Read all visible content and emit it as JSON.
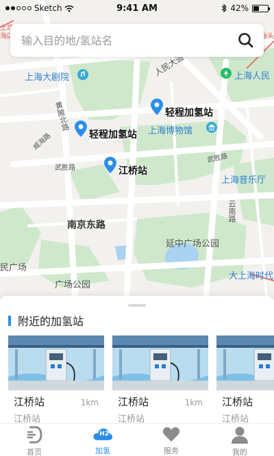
{
  "status_bar": {
    "carrier": "Sketch",
    "time": "9:41 AM",
    "battery": "42%",
    "battery_level": 0.42
  },
  "search": {
    "placeholder": "输入目的地/氢站名"
  },
  "map": {
    "labels": {
      "shanghai_grand_theatre": "上海大剧院",
      "peoples_avenue": "人民大道",
      "shanghai_peoples": "上海人民",
      "huangpi_north_road": "黄陂北路",
      "weihai_road": "威海路",
      "wusheng_road_left": "武胜路",
      "shanghai_museum": "上海博物馆",
      "wusheng_road_right": "武胜路",
      "shanghai_concert_hall": "上海音乐厅",
      "nanjing_east_road": "南京东路",
      "yunnan_road": "云南路",
      "yanzhong_park": "延中广场公园",
      "min_square": "民广场",
      "square_park": "广场公园",
      "shanghai_times": "大上海时代",
      "edge_top_left": "上场\n海店",
      "edge_top_right": "上海头"
    },
    "stations": {
      "station_a": "轻程加氢站",
      "station_b": "轻程加氢站",
      "station_c": "江桥站"
    }
  },
  "sheet": {
    "title": "附近的加氢站",
    "stations": [
      {
        "name": "江桥站",
        "distance": "1km",
        "address": "江桥站"
      },
      {
        "name": "江桥站",
        "distance": "1km",
        "address": "江桥站"
      },
      {
        "name": "江桥站",
        "distance": "",
        "address": "江桥站"
      }
    ]
  },
  "tabbar": {
    "tabs": [
      {
        "label": "首页",
        "icon": "home-logo-icon"
      },
      {
        "label": "加氢",
        "icon": "h2-cloud-icon",
        "badge": "H2"
      },
      {
        "label": "服务",
        "icon": "heart-icon"
      },
      {
        "label": "我的",
        "icon": "user-icon"
      }
    ]
  },
  "colors": {
    "accent": "#2a8ee8",
    "park_green": "#cfe8cc",
    "water": "#a9d3f0",
    "map_bg": "#f3f1ee"
  }
}
